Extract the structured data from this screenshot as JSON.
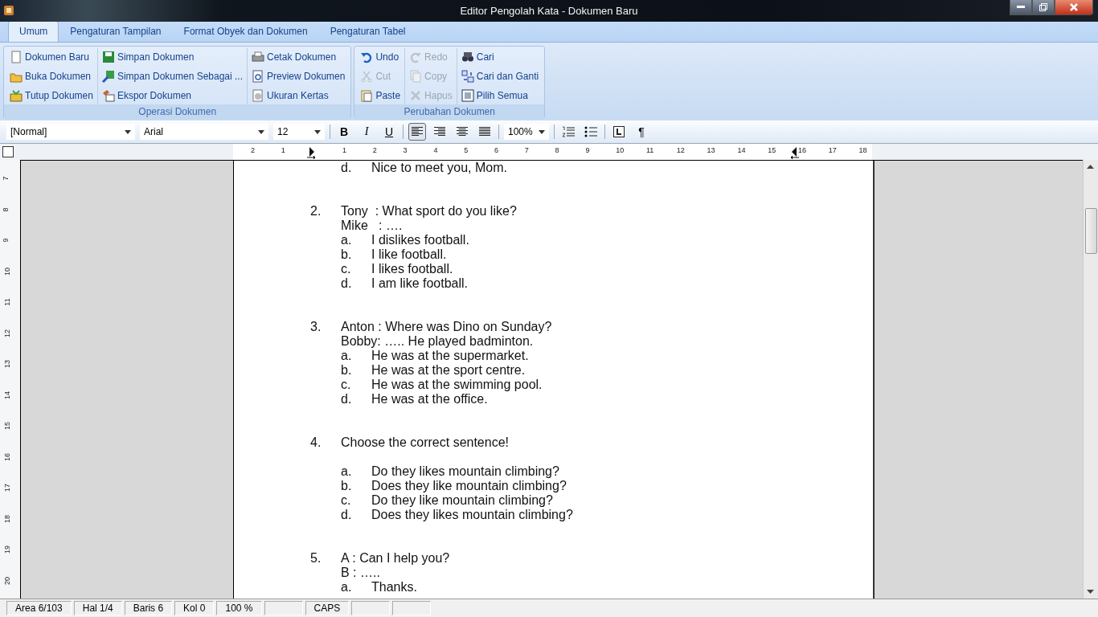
{
  "window": {
    "title": "Editor Pengolah Kata - Dokumen Baru"
  },
  "tabs": [
    {
      "label": "Umum",
      "selected": true
    },
    {
      "label": "Pengaturan Tampilan",
      "selected": false
    },
    {
      "label": "Format Obyek dan Dokumen",
      "selected": false
    },
    {
      "label": "Pengaturan Tabel",
      "selected": false
    }
  ],
  "ribbon_groups": [
    {
      "title": "Operasi Dokumen",
      "columns": [
        [
          {
            "label": "Dokumen Baru",
            "disabled": false
          },
          {
            "label": "Buka Dokumen",
            "disabled": false
          },
          {
            "label": "Tutup Dokumen",
            "disabled": false
          }
        ],
        [
          {
            "label": "Simpan Dokumen",
            "disabled": false
          },
          {
            "label": "Simpan Dokumen Sebagai ...",
            "disabled": false
          },
          {
            "label": "Ekspor Dokumen",
            "disabled": false
          }
        ],
        [
          {
            "label": "Cetak Dokumen",
            "disabled": false
          },
          {
            "label": "Preview Dokumen",
            "disabled": false
          },
          {
            "label": "Ukuran Kertas",
            "disabled": false
          }
        ]
      ]
    },
    {
      "title": "Perubahan Dokumen",
      "columns": [
        [
          {
            "label": "Undo",
            "disabled": false
          },
          {
            "label": "Cut",
            "disabled": true
          },
          {
            "label": "Paste",
            "disabled": false
          }
        ],
        [
          {
            "label": "Redo",
            "disabled": true
          },
          {
            "label": "Copy",
            "disabled": true
          },
          {
            "label": "Hapus",
            "disabled": true
          }
        ],
        [
          {
            "label": "Cari",
            "disabled": false
          },
          {
            "label": "Cari dan Ganti",
            "disabled": false
          },
          {
            "label": "Pilih Semua",
            "disabled": false
          }
        ]
      ]
    }
  ],
  "format_toolbar": {
    "style": "[Normal]",
    "font": "Arial",
    "size": "12",
    "bold": "B",
    "italic": "I",
    "underline": "U",
    "alignments": [
      {
        "selected": true
      },
      {
        "selected": false
      },
      {
        "selected": false
      },
      {
        "selected": false
      }
    ],
    "zoom": "100%",
    "pilcrow": "¶"
  },
  "ruler": {
    "left_numbers": [
      "2",
      "1"
    ],
    "right_numbers": [
      "1",
      "2",
      "3",
      "4",
      "5",
      "6",
      "7",
      "8",
      "9",
      "10",
      "11",
      "12",
      "13",
      "14",
      "15",
      "16",
      "17",
      "18"
    ],
    "vertical_numbers": [
      "7",
      "8",
      "9",
      "10",
      "11",
      "12",
      "13",
      "14",
      "15",
      "16",
      "17",
      "18",
      "19",
      "20"
    ]
  },
  "document": {
    "fragment": {
      "letter": "d.",
      "text": "Nice to meet you, Mom."
    },
    "questions": [
      {
        "number": "2.",
        "lines": [
          "Tony  : What sport do you like?",
          "Mike   : …."
        ],
        "gap_before_options": false,
        "options": [
          {
            "letter": "a.",
            "text": "I dislikes football."
          },
          {
            "letter": "b.",
            "text": "I like football."
          },
          {
            "letter": "c.",
            "text": "I likes football."
          },
          {
            "letter": "d.",
            "text": "I am like football."
          }
        ]
      },
      {
        "number": "3.",
        "lines": [
          "Anton : Where was Dino on Sunday?",
          "Bobby: ….. He played badminton."
        ],
        "gap_before_options": false,
        "options": [
          {
            "letter": "a.",
            "text": "He was at the supermarket."
          },
          {
            "letter": "b.",
            "text": "He was at the sport centre."
          },
          {
            "letter": "c.",
            "text": "He was at the swimming pool."
          },
          {
            "letter": "d.",
            "text": "He was at the office."
          }
        ]
      },
      {
        "number": "4.",
        "lines": [
          "Choose the correct sentence!"
        ],
        "gap_before_options": true,
        "options": [
          {
            "letter": "a.",
            "text": "Do they likes mountain climbing?"
          },
          {
            "letter": "b.",
            "text": "Does they like mountain climbing?"
          },
          {
            "letter": "c.",
            "text": "Do they like mountain climbing?"
          },
          {
            "letter": "d.",
            "text": "Does they likes mountain climbing?"
          }
        ]
      },
      {
        "number": "5.",
        "lines": [
          "A : Can I help you?",
          "B : ….."
        ],
        "gap_before_options": false,
        "options": [
          {
            "letter": "a.",
            "text": "Thanks."
          }
        ]
      }
    ]
  },
  "status_bar": [
    {
      "kind": "text",
      "text": "Area 6/103"
    },
    {
      "kind": "text",
      "text": "Hal 1/4"
    },
    {
      "kind": "text",
      "text": "Baris 6"
    },
    {
      "kind": "text",
      "text": "Kol 0"
    },
    {
      "kind": "text",
      "text": "100 %"
    },
    {
      "kind": "blank"
    },
    {
      "kind": "text",
      "text": "CAPS"
    },
    {
      "kind": "blank"
    },
    {
      "kind": "blank"
    }
  ]
}
